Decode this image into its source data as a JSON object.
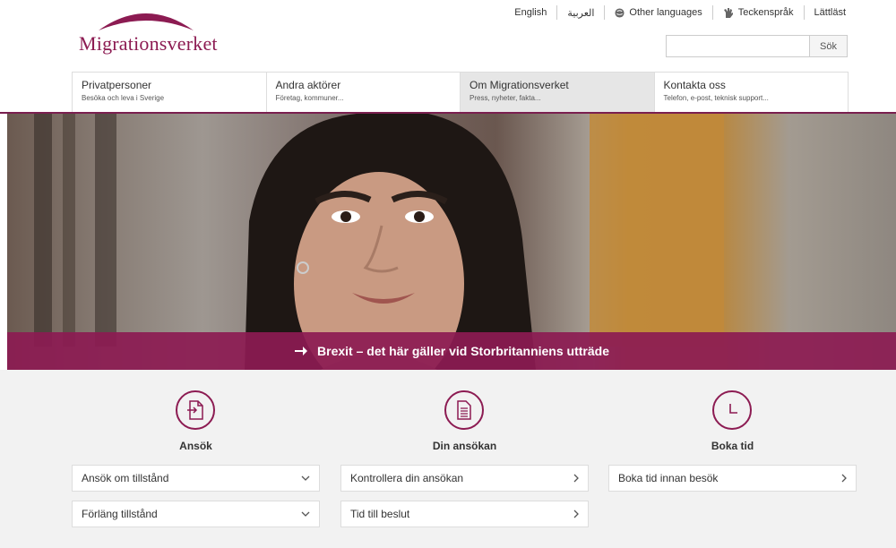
{
  "header": {
    "logo_text": "Migrationsverket",
    "toplinks": [
      {
        "label": "English",
        "icon": ""
      },
      {
        "label": "العربية",
        "icon": ""
      },
      {
        "label": "Other languages",
        "icon": "globe-icon"
      },
      {
        "label": "Teckenspråk",
        "icon": "sign-language-icon"
      },
      {
        "label": "Lättläst",
        "icon": ""
      }
    ],
    "search_button": "Sök",
    "search_placeholder": ""
  },
  "nav": [
    {
      "title": "Privatpersoner",
      "sub": "Besöka och leva i Sverige"
    },
    {
      "title": "Andra aktörer",
      "sub": "Företag, kommuner..."
    },
    {
      "title": "Om Migrationsverket",
      "sub": "Press, nyheter, fakta..."
    },
    {
      "title": "Kontakta oss",
      "sub": "Telefon, e-post, teknisk support..."
    }
  ],
  "hero": {
    "banner_text": "Brexit – det här gäller vid Storbritanniens utträde"
  },
  "columns": [
    {
      "title": "Ansök",
      "icon": "apply-document-icon",
      "buttons": [
        "Ansök om tillstånd",
        "Förläng tillstånd"
      ],
      "chevrons": [
        "chevron-down-icon",
        "chevron-down-icon"
      ]
    },
    {
      "title": "Din ansökan",
      "icon": "document-icon",
      "buttons": [
        "Kontrollera din ansökan",
        "Tid till beslut"
      ],
      "chevrons": [
        "chevron-right-icon",
        "chevron-right-icon"
      ]
    },
    {
      "title": "Boka tid",
      "icon": "clock-icon",
      "buttons": [
        "Boka tid innan besök"
      ],
      "chevrons": [
        "chevron-right-icon"
      ]
    }
  ],
  "colors": {
    "brand": "#8c1b52",
    "nav_active": "#e6e6e6",
    "lower_bg": "#f2f2f2"
  }
}
